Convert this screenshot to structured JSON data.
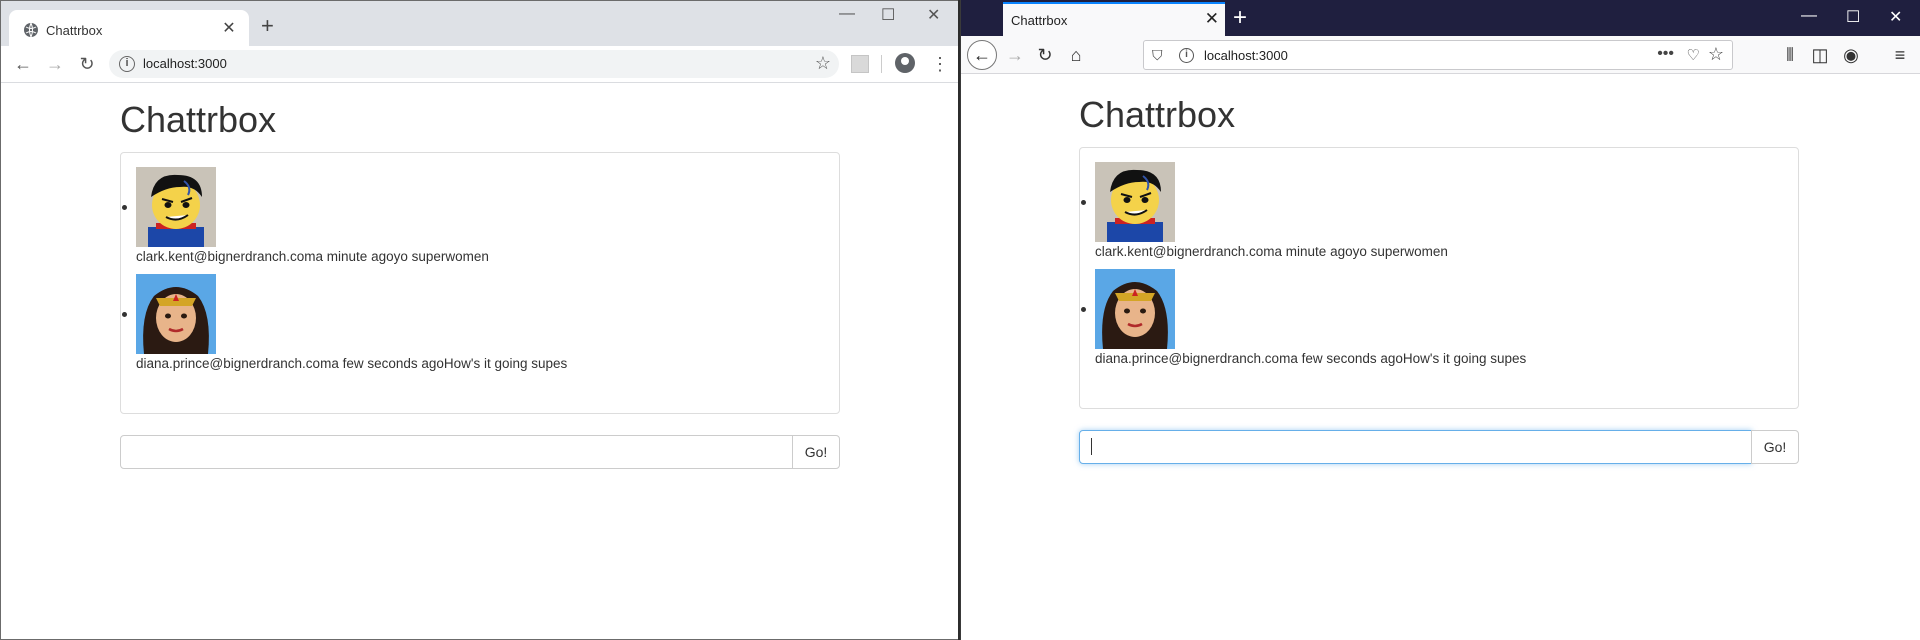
{
  "chrome": {
    "tab_title": "Chattrbox",
    "url": "localhost:3000",
    "icons": [
      "globe-icon",
      "close-icon",
      "plus-icon",
      "back-icon",
      "forward-icon",
      "reload-icon",
      "info-icon",
      "star-icon",
      "profile-icon",
      "menu-icon"
    ]
  },
  "firefox": {
    "tab_title": "Chattrbox",
    "url": "localhost:3000",
    "icons": [
      "back-icon",
      "forward-icon",
      "reload-icon",
      "home-icon",
      "shield-icon",
      "info-icon",
      "more-icon",
      "pocket-icon",
      "star-icon",
      "library-icon",
      "sidebar-icon",
      "account-icon",
      "menu-icon"
    ]
  },
  "page": {
    "title": "Chattrbox",
    "messages": [
      {
        "user": "clark.kent@bignerdranch.com",
        "time": "a minute ago",
        "text": "yo superwomen",
        "full": "clark.kent@bignerdranch.coma minute agoyo superwomen"
      },
      {
        "user": "diana.prince@bignerdranch.com",
        "time": "a few seconds ago",
        "text": "How's it going supes",
        "full": "diana.prince@bignerdranch.coma few seconds agoHow's it going supes"
      }
    ],
    "input_value": "",
    "go_label": "Go!"
  },
  "colors": {
    "chrome_tabstrip": "#dee1e6",
    "firefox_tabstrip": "#1f1f3f",
    "focus_ring": "#66afe9"
  }
}
